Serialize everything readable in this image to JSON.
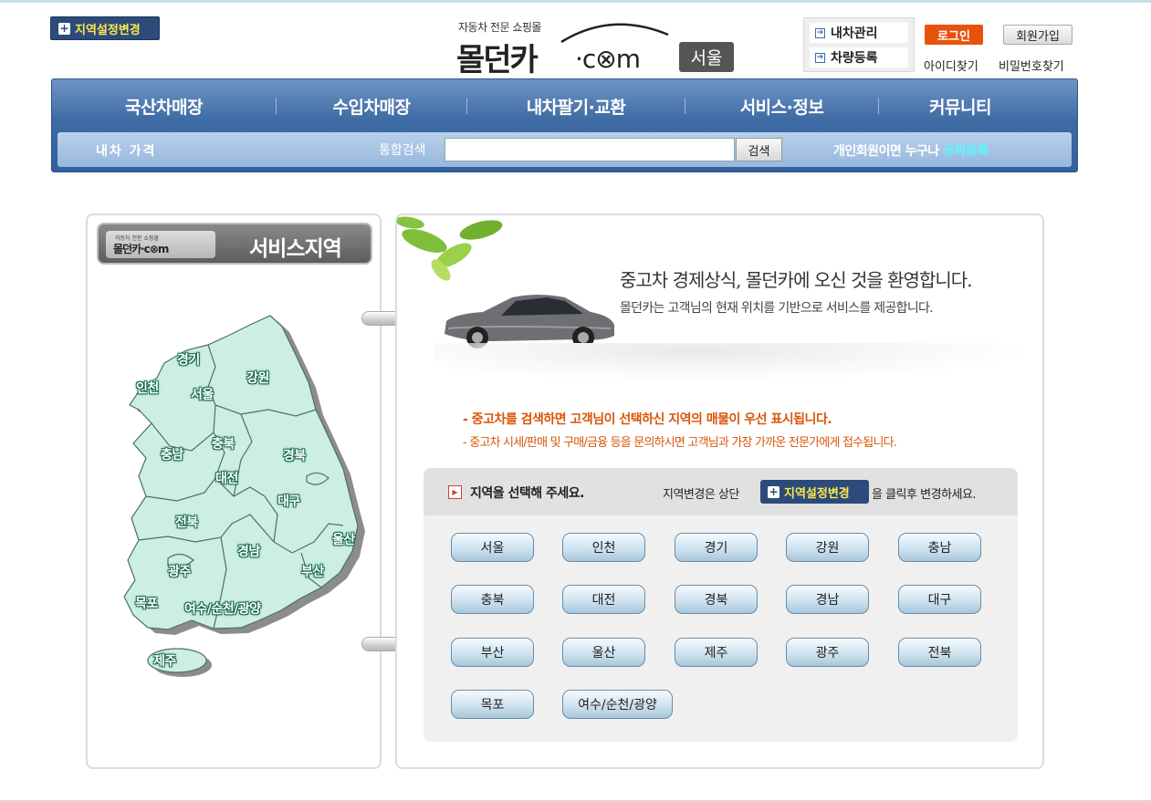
{
  "header": {
    "region_change_label": "지역설정변경",
    "logo_sub": "자동차 전문 쇼핑몰",
    "logo_main": "몰던카",
    "logo_com": "·c⊗m",
    "city": "서울",
    "mycar_items": [
      "내차관리",
      "차량등록"
    ],
    "login_label": "로그인",
    "join_label": "회원가입",
    "find_id_label": "아이디찾기",
    "find_pw_label": "비밀번호찾기"
  },
  "nav": {
    "menu": [
      "국산차매장",
      "수입차매장",
      "내차팔기·교환",
      "서비스·정보",
      "커뮤니티"
    ],
    "car_price_label": "내차 가격",
    "search_label": "통합검색",
    "search_value": "",
    "search_button": "검색",
    "promo_text": "개인회원이면 누구나 ",
    "promo_link": "공짜등록"
  },
  "left_panel": {
    "mini_logo_sub": "자동차 전문 쇼핑몰",
    "mini_logo_main": "몰던카·c⊗m",
    "title": "서비스지역",
    "map_labels": [
      {
        "name": "경기"
      },
      {
        "name": "인천"
      },
      {
        "name": "서울"
      },
      {
        "name": "강원"
      },
      {
        "name": "충남"
      },
      {
        "name": "충북"
      },
      {
        "name": "대전"
      },
      {
        "name": "경북"
      },
      {
        "name": "대구"
      },
      {
        "name": "전북"
      },
      {
        "name": "경남"
      },
      {
        "name": "울산"
      },
      {
        "name": "광주"
      },
      {
        "name": "부산"
      },
      {
        "name": "목포"
      },
      {
        "name": "여수/순천/광양"
      },
      {
        "name": "제주"
      }
    ]
  },
  "right_panel": {
    "welcome_title": "중고차 경제상식, 몰던카에 오신 것을 환영합니다.",
    "welcome_sub": "몰던카는 고객님의 현재 위치를 기반으로 서비스를 제공합니다.",
    "notice_1": "- 중고차를 검색하면 고객님이 선택하신 지역의 매물이 우선  표시됩니다.",
    "notice_2": "- 중고차 시세/판매 및 구매/금융 등을 문의하시면 고객님과 가장 가까운 전문가에게 접수됩니다.",
    "select_title": "지역을 선택해 주세요.",
    "change_pre": "지역변경은 상단",
    "change_button": "지역설정변경",
    "change_post": "을 클릭후 변경하세요.",
    "regions": [
      "서울",
      "인천",
      "경기",
      "강원",
      "충남",
      "충북",
      "대전",
      "경북",
      "경남",
      "대구",
      "부산",
      "울산",
      "제주",
      "광주",
      "전북",
      "목포",
      "여수/순천/광양"
    ]
  },
  "colors": {
    "nav_blue": "#3e6aa4",
    "accent_orange": "#e8520c",
    "notice_orange": "#d9560a",
    "badge_navy": "#2c4a7a",
    "map_fill": "#cdeee4",
    "link_cyan": "#5ff4ff"
  }
}
